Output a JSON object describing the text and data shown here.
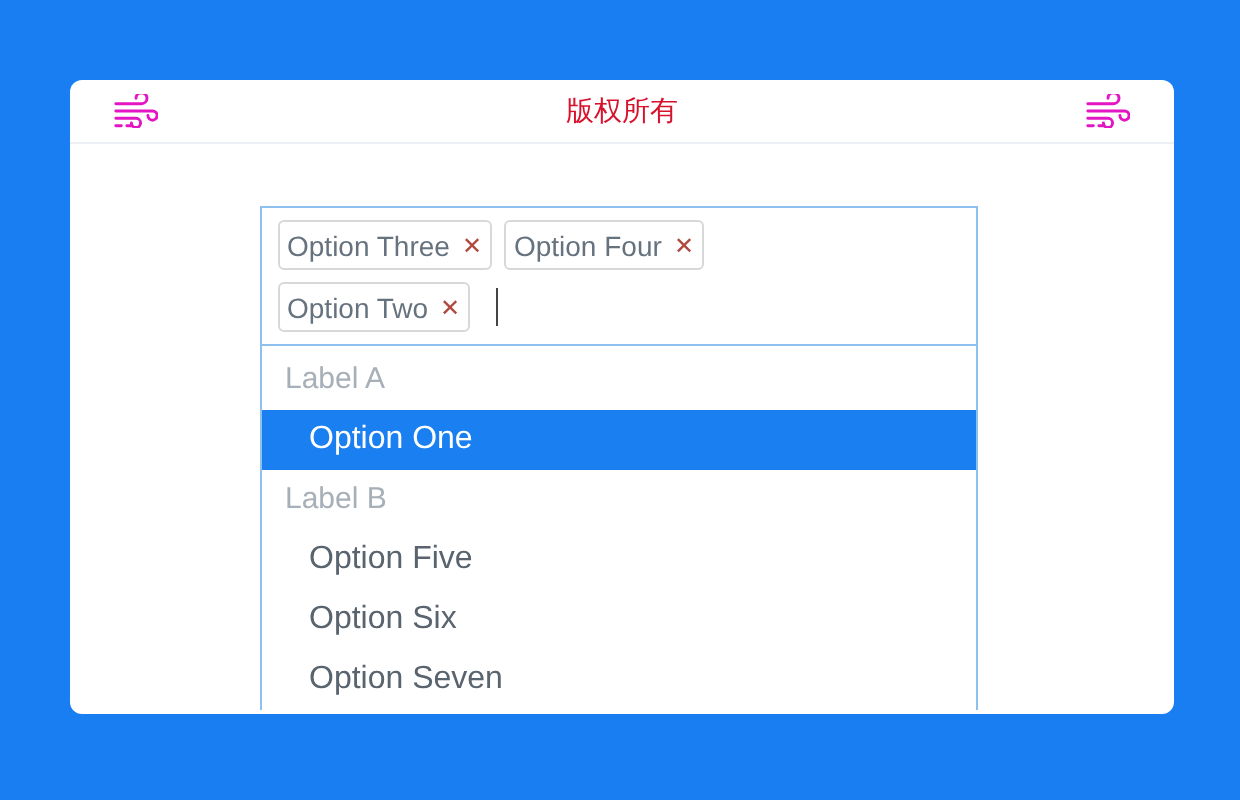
{
  "header": {
    "title": "版权所有"
  },
  "select": {
    "tags": [
      {
        "label": "Option Three",
        "remove": "✕"
      },
      {
        "label": "Option Four",
        "remove": "✕"
      },
      {
        "label": "Option Two",
        "remove": "✕"
      }
    ],
    "groups": [
      {
        "label": "Label A",
        "options": [
          {
            "label": "Option One",
            "selected": true
          }
        ]
      },
      {
        "label": "Label B",
        "options": [
          {
            "label": "Option Five",
            "selected": false
          },
          {
            "label": "Option Six",
            "selected": false
          },
          {
            "label": "Option Seven",
            "selected": false
          }
        ]
      }
    ]
  }
}
